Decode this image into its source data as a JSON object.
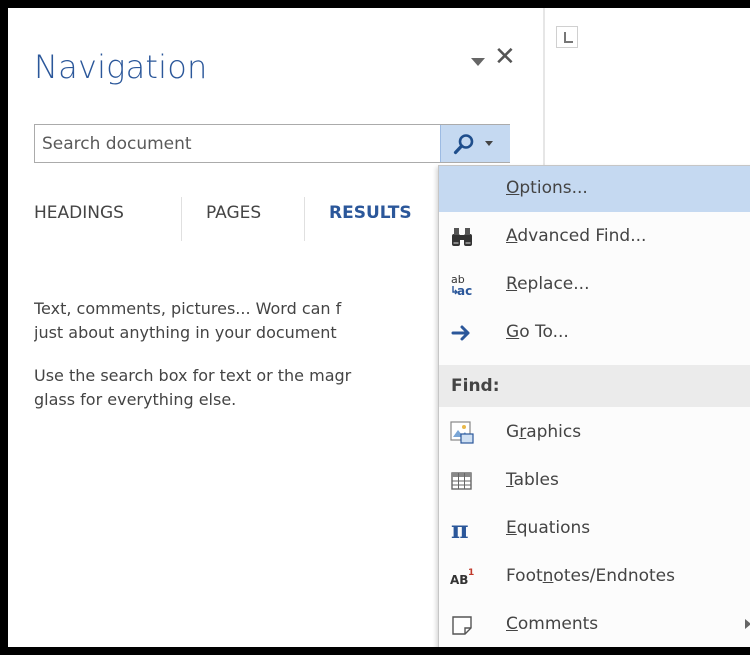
{
  "pane": {
    "title": "Navigation",
    "search_placeholder": "Search document",
    "tabs": [
      "HEADINGS",
      "PAGES",
      "RESULTS"
    ],
    "active_tab": "RESULTS",
    "help_paragraph_1": [
      "Text, comments, pictures... Word can f",
      "just about anything in your document"
    ],
    "help_paragraph_2": [
      "Use the search box for text or the magr",
      "glass for everything else."
    ]
  },
  "menu": {
    "items": [
      {
        "label": "Options...",
        "underline": "O",
        "icon": "none",
        "highlighted": true
      },
      {
        "label": "Advanced Find...",
        "underline": "A",
        "icon": "binoculars-icon"
      },
      {
        "label": "Replace...",
        "underline": "R",
        "icon": "replace-icon"
      },
      {
        "label": "Go To...",
        "underline": "G",
        "icon": "arrow-right-icon"
      }
    ],
    "section_title": "Find:",
    "find_items": [
      {
        "label": "Graphics",
        "underline": "r",
        "icon": "graphics-icon"
      },
      {
        "label": "Tables",
        "underline": "T",
        "icon": "table-icon"
      },
      {
        "label": "Equations",
        "underline": "E",
        "icon": "pi-icon"
      },
      {
        "label": "Footnotes/Endnotes",
        "underline": "n",
        "icon": "footnote-icon"
      },
      {
        "label": "Comments",
        "underline": "C",
        "icon": "comment-icon",
        "has_submenu": true
      }
    ]
  },
  "colors": {
    "accent": "#2b579a",
    "highlight": "#c5d9f1",
    "section_bg": "#ebebeb",
    "text": "#444444"
  }
}
